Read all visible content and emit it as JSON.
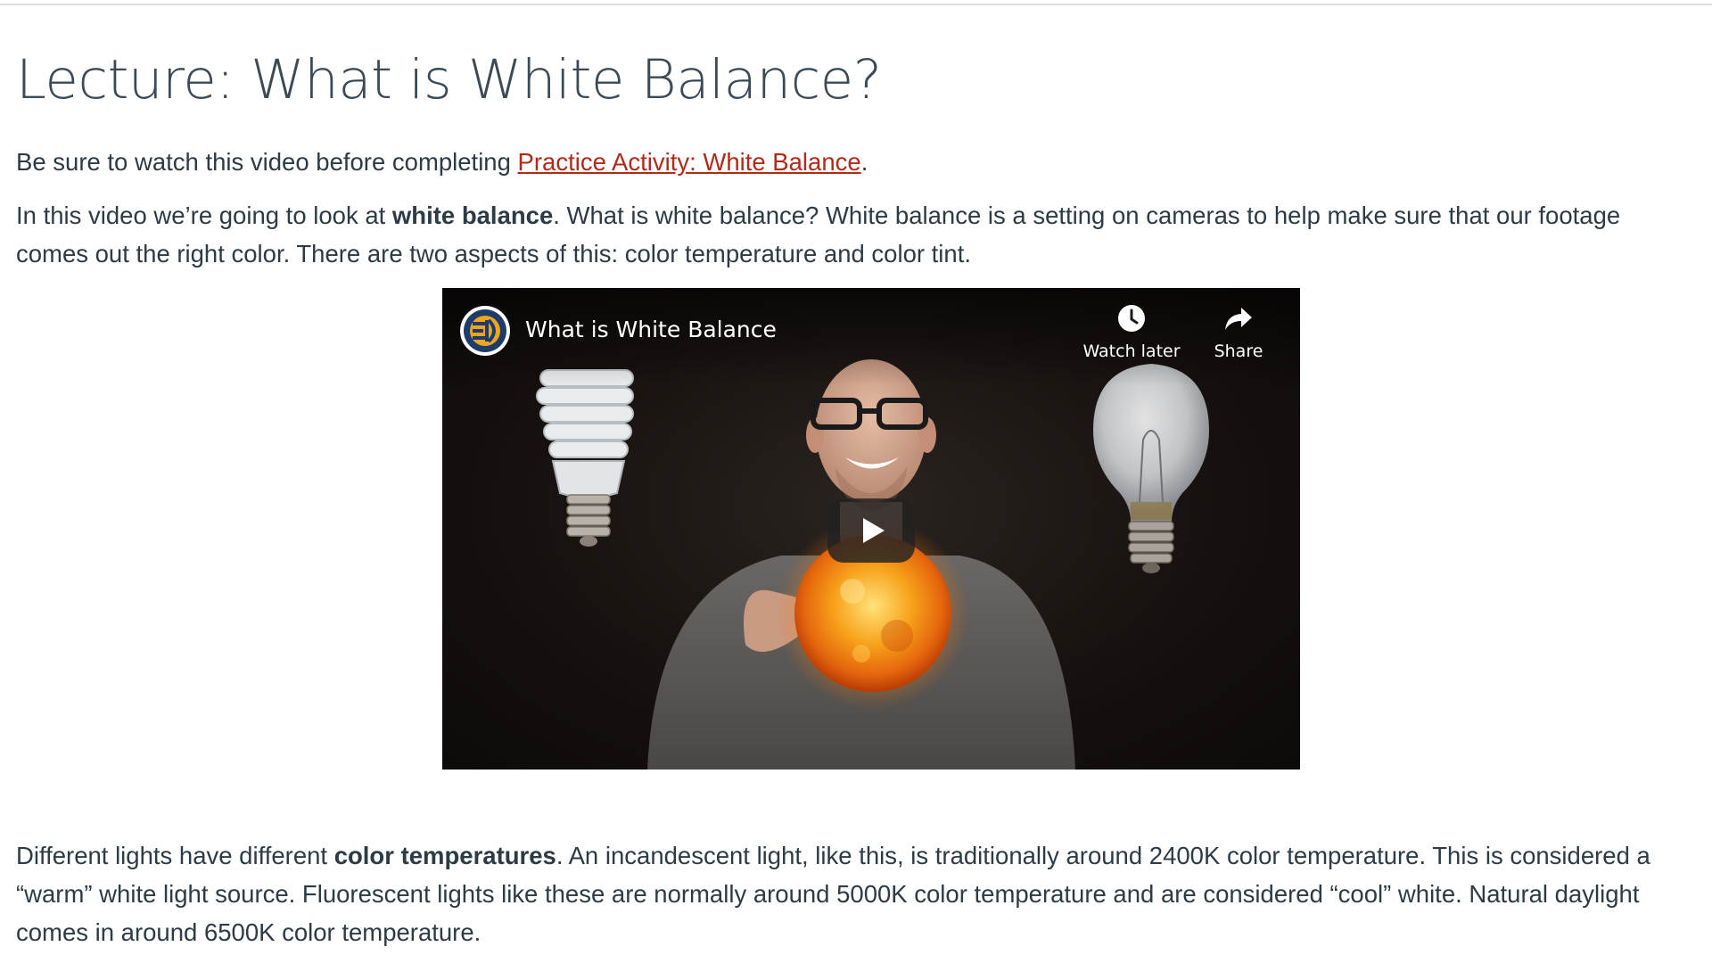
{
  "page": {
    "title": "Lecture: What is White Balance?",
    "intro_before_link": "Be sure to watch this video before completing ",
    "intro_link": "Practice Activity: White Balance",
    "intro_after_link": ".",
    "para1_before_bold": "In this video we’re going to look at ",
    "para1_bold": "white balance",
    "para1_after_bold": ". What is white balance? White balance is a setting on cameras to help make sure that our footage comes out the right color. There are two aspects of this: color temperature and color tint.",
    "para2_before_bold": "Different lights have different ",
    "para2_bold": "color temperatures",
    "para2_after_bold": ". An incandescent light, like this, is traditionally around 2400K color temperature. This is considered a “warm” white light source. Fluorescent lights like these are normally around 5000K color temperature and are considered “cool” white.  Natural daylight comes in around 6500K color temperature."
  },
  "video": {
    "title": "What is White Balance",
    "watch_later_label": "Watch later",
    "share_label": "Share",
    "icons": {
      "channel": "channel-logo-icon",
      "watch_later": "clock-icon",
      "share": "share-arrow-icon",
      "play": "play-icon"
    }
  },
  "colors": {
    "link": "#b22a18",
    "text": "#2d3b45",
    "title": "#3b4a55"
  }
}
